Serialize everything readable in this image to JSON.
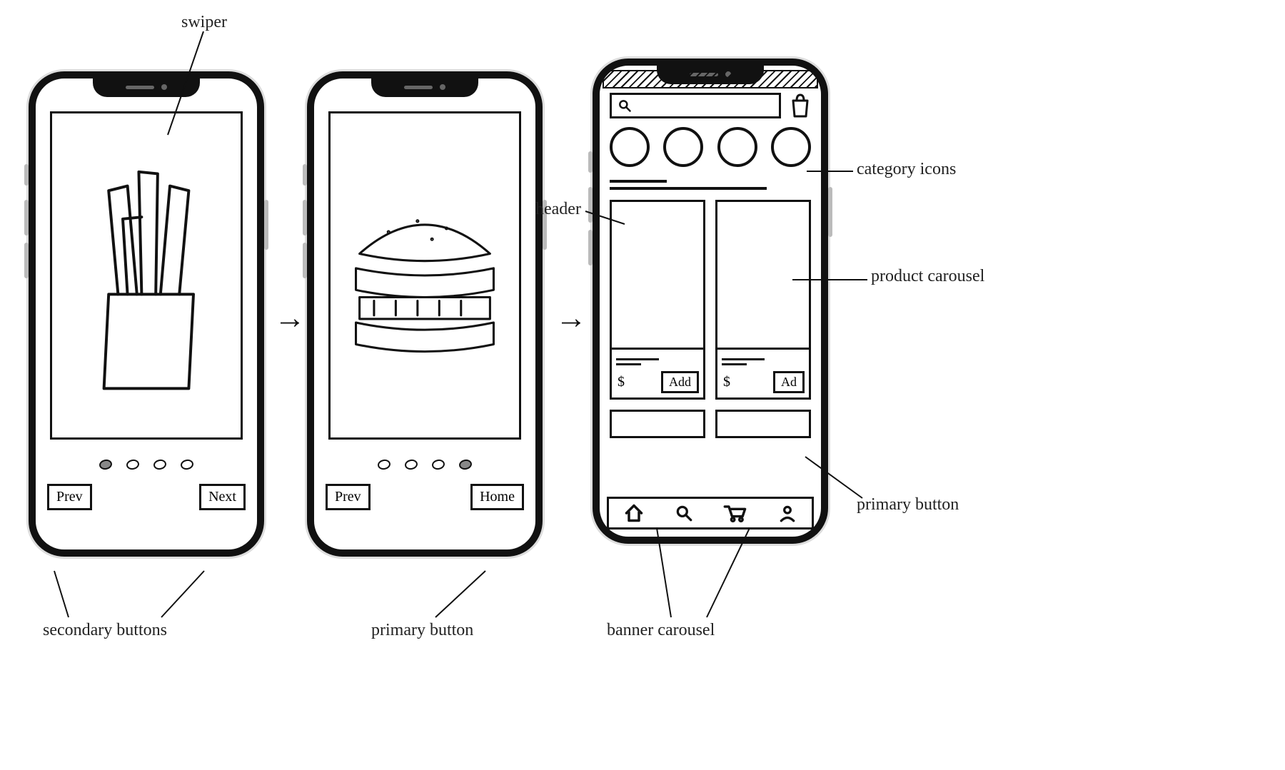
{
  "annotations": {
    "swiper": "swiper",
    "secondary_buttons": "secondary buttons",
    "primary_button_onboarding": "primary button",
    "header": "header",
    "category_icons": "category icons",
    "product_carousel": "product carousel",
    "primary_button_card": "primary button",
    "banner_carousel": "banner carousel"
  },
  "onboarding": {
    "screen1": {
      "image": "fries",
      "dots_active_index": 0,
      "prev_label": "Prev",
      "next_label": "Next"
    },
    "screen2": {
      "image": "burger",
      "dots_active_index": 3,
      "prev_label": "Prev",
      "home_label": "Home"
    }
  },
  "home": {
    "search_placeholder": "",
    "categories_count": 4,
    "product_cards": [
      {
        "price_symbol": "$",
        "add_label": "Add"
      },
      {
        "price_symbol": "$",
        "add_label": "Ad"
      }
    ],
    "tabs": [
      "home",
      "search",
      "cart",
      "account"
    ]
  }
}
